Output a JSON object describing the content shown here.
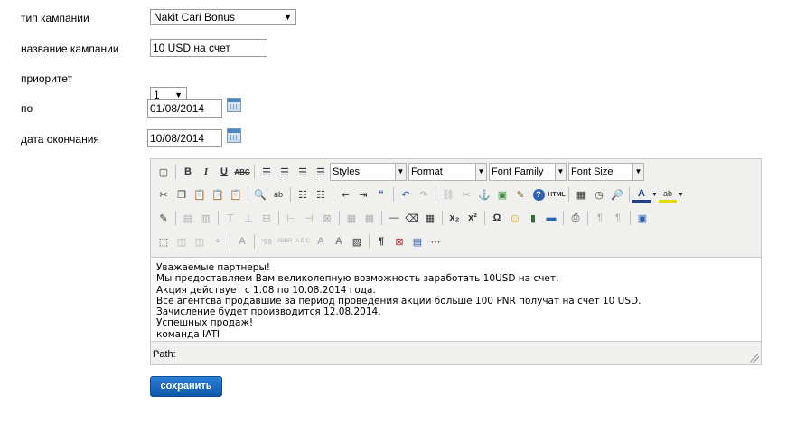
{
  "form": {
    "campaign_type": {
      "label": "тип кампании",
      "value": "Nakit Cari Bonus"
    },
    "campaign_name": {
      "label": "название кампании",
      "value": "10 USD на счет"
    },
    "priority": {
      "label": "приоритет",
      "value": "1"
    },
    "start": {
      "label": "по",
      "value": "01/08/2014"
    },
    "end": {
      "label": "дата окончания",
      "value": "10/08/2014"
    }
  },
  "editor": {
    "dropdowns": {
      "styles": "Styles",
      "format": "Format",
      "font_family": "Font Family",
      "font_size": "Font Size"
    },
    "content_lines": [
      "Уважаемые партнеры!",
      "Мы предоставляем Вам великолепную возможность заработать 10USD на счет.",
      "Акция действует с 1.08 по 10.08.2014 года.",
      "Все агентсва продавшие за период проведения акции больше 100 PNR получат на счет 10 USD.",
      "Зачисление будет производится 12.08.2014.",
      "Успешных продаж!",
      "команда IATI"
    ],
    "path_label": "Path:"
  },
  "buttons": {
    "save": "сохранить"
  },
  "colors": {
    "accent": "#1565c0",
    "toolbar_bg": "#f0f0ee"
  }
}
